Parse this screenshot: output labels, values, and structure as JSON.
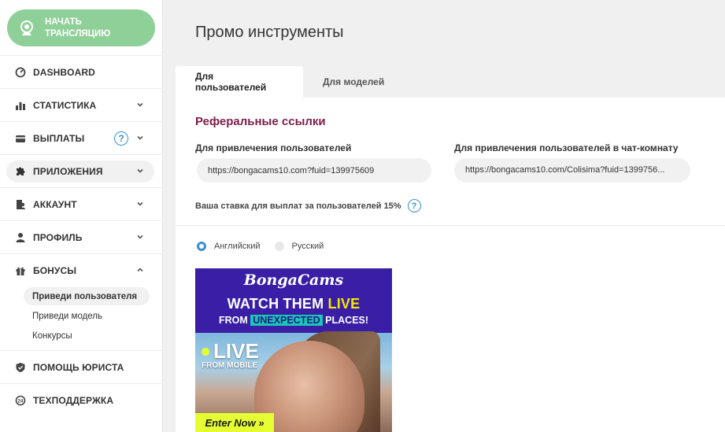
{
  "sidebar": {
    "stream_button": {
      "line1": "НАЧАТЬ",
      "line2": "ТРАНСЛЯЦИЮ"
    },
    "items": [
      {
        "label": "DASHBOARD",
        "icon": "dashboard-icon",
        "chevron": ""
      },
      {
        "label": "СТАТИСТИКА",
        "icon": "bar-chart-icon",
        "chevron": "down"
      },
      {
        "label": "ВЫПЛАТЫ",
        "icon": "card-icon",
        "chevron": "down",
        "help": "?"
      },
      {
        "label": "ПРИЛОЖЕНИЯ",
        "icon": "puzzle-icon",
        "chevron": "down"
      },
      {
        "label": "АККАУНТ",
        "icon": "account-icon",
        "chevron": "down"
      },
      {
        "label": "ПРОФИЛЬ",
        "icon": "user-icon",
        "chevron": "down"
      },
      {
        "label": "БОНУСЫ",
        "icon": "gift-icon",
        "chevron": "up"
      },
      {
        "label": "ПОМОЩЬ ЮРИСТА",
        "icon": "shield-icon",
        "chevron": ""
      },
      {
        "label": "ТЕХПОДДЕРЖКА",
        "icon": "support-icon",
        "chevron": ""
      }
    ],
    "bonus_sub": [
      "Приведи пользователя",
      "Приведи модель",
      "Конкурсы"
    ]
  },
  "main": {
    "title": "Промо инструменты",
    "tabs": [
      "Для пользователей",
      "Для моделей"
    ],
    "section_title": "Реферальные ссылки",
    "label_users": "Для привлечения пользователей",
    "label_chat": "Для привлечения пользователей в чат-комнату",
    "link_users": "https://bongacams10.com?fuid=139975609",
    "link_chat": "https://bongacams10.com/Colisima?fuid=1399756...",
    "rate_text": "Ваша ставка для выплат за пользователей 15%",
    "rate_help": "?",
    "languages": [
      "Английский",
      "Русский"
    ]
  },
  "banner": {
    "logo": "BongaCams",
    "headline_pre": "WATCH THEM ",
    "headline_live": "LIVE",
    "sub_pre": "FROM ",
    "sub_hl": "UNEXPECTED",
    "sub_post": " PLACES!",
    "live": "LIVE",
    "from_mobile": "FROM MOBILE",
    "enter": "Enter Now »"
  },
  "colors": {
    "stream_green": "#8fcf98",
    "section_title": "#7a1e4a",
    "accent_blue": "#3a8fd6",
    "banner_purple": "#3a1ea6",
    "banner_yellow": "#e6ff33"
  }
}
